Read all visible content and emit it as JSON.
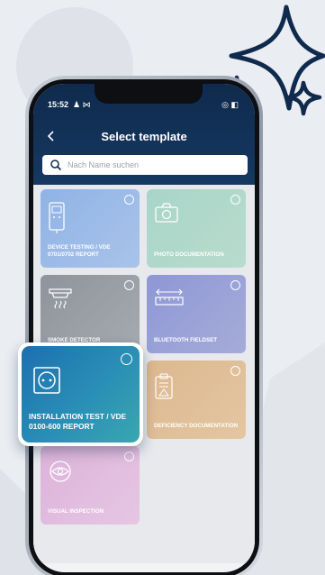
{
  "status_bar": {
    "time": "15:52",
    "left_icons": "♟ ⋈",
    "right_icons": "◎ ◧"
  },
  "header": {
    "title": "Select template",
    "back_icon": "chevron-left-icon"
  },
  "search": {
    "placeholder": "Nach Name suchen"
  },
  "templates": [
    {
      "label": "DEVICE TESTING / VDE 0701/0702 REPORT",
      "icon": "device-tester-icon",
      "color": "#8fb3e6"
    },
    {
      "label": "PHOTO DOCUMENTATION",
      "icon": "camera-icon",
      "color": "#a8d5c8"
    },
    {
      "label": "SMOKE DETECTOR",
      "icon": "smoke-detector-icon",
      "color": "#8f949c"
    },
    {
      "label": "BLUETOOTH FIELDSET",
      "icon": "ruler-icon",
      "color": "#8e97d6"
    },
    {
      "label": "INSTALLATION TEST / VDE 0100-600 REPORT",
      "icon": "socket-icon",
      "color": "#1d6fb0",
      "highlighted": true
    },
    {
      "label": "DEFICIENCY DOCUMENTATION",
      "icon": "clipboard-warning-icon",
      "color": "#dcb88e"
    },
    {
      "label": "VISUAL INSPECTION",
      "icon": "eye-icon",
      "color": "#dcb3da"
    }
  ]
}
